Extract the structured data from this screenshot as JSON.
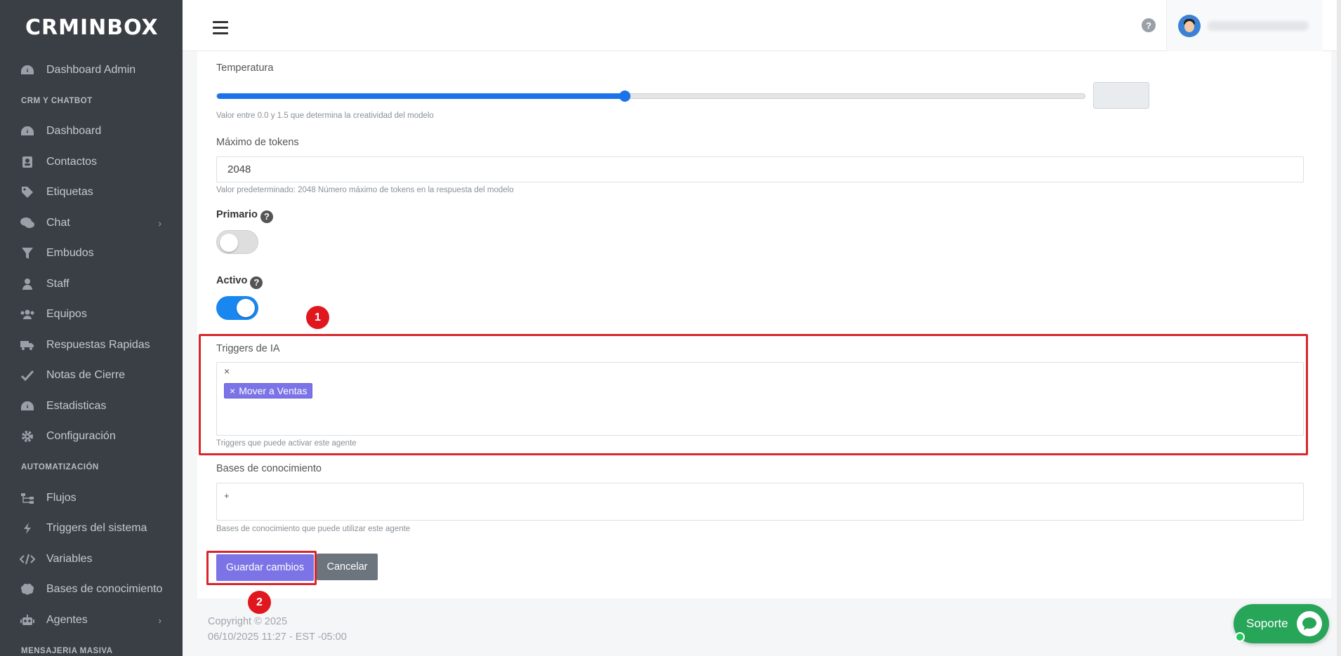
{
  "app": {
    "logo": "CRMINBOX"
  },
  "sidebar": {
    "items": [
      {
        "label": "Dashboard Admin",
        "icon": "dashboard-icon"
      },
      {
        "section": "CRM Y CHATBOT"
      },
      {
        "label": "Dashboard",
        "icon": "dashboard-icon"
      },
      {
        "label": "Contactos",
        "icon": "contacts-icon"
      },
      {
        "label": "Etiquetas",
        "icon": "tag-icon"
      },
      {
        "label": "Chat",
        "icon": "chat-icon",
        "chevron": "›"
      },
      {
        "label": "Embudos",
        "icon": "funnel-icon"
      },
      {
        "label": "Staff",
        "icon": "user-icon"
      },
      {
        "label": "Equipos",
        "icon": "users-icon"
      },
      {
        "label": "Respuestas Rapidas",
        "icon": "truck-icon"
      },
      {
        "label": "Notas de Cierre",
        "icon": "check-icon"
      },
      {
        "label": "Estadisticas",
        "icon": "dashboard-icon"
      },
      {
        "label": "Configuración",
        "icon": "gear-icon"
      },
      {
        "section": "AUTOMATIZACIÓN"
      },
      {
        "label": "Flujos",
        "icon": "sitemap-icon"
      },
      {
        "label": "Triggers del sistema",
        "icon": "bolt-icon"
      },
      {
        "label": "Variables",
        "icon": "code-icon"
      },
      {
        "label": "Bases de conocimiento",
        "icon": "brain-icon"
      },
      {
        "label": "Agentes",
        "icon": "robot-icon",
        "chevron": "›"
      },
      {
        "section": "MENSAJERIA MASIVA"
      }
    ]
  },
  "topbar": {
    "help": "?"
  },
  "form": {
    "temperature": {
      "label": "Temperatura",
      "value": 0.47,
      "hint": "Valor entre 0.0 y 1.5 que determina la creatividad del modelo"
    },
    "max_tokens": {
      "label": "Máximo de tokens",
      "value": "2048",
      "hint": "Valor predeterminado: 2048 Número máximo de tokens en la respuesta del modelo"
    },
    "primary": {
      "label": "Primario",
      "help": "?",
      "checked": false
    },
    "active": {
      "label": "Activo",
      "help": "?",
      "checked": true
    },
    "triggers": {
      "label": "Triggers de IA",
      "clear": "×",
      "tags": [
        {
          "remove": "×",
          "label": "Mover a Ventas"
        }
      ],
      "hint": "Triggers que puede activar este agente"
    },
    "knowledge": {
      "label": "Bases de conocimiento",
      "placeholder": "+",
      "hint": "Bases de conocimiento que puede utilizar este agente"
    },
    "save_label": "Guardar cambios",
    "cancel_label": "Cancelar"
  },
  "annotations": {
    "one": "1",
    "two": "2",
    "color": "#d9252b"
  },
  "footer": {
    "copyright": "Copyright © 2025",
    "datetime": "06/10/2025 11:27 - EST -05:00"
  },
  "support": {
    "label": "Soporte",
    "color": "#27a559"
  },
  "colors": {
    "sidebar": "#3a3f45",
    "accent": "#7b73e6",
    "toggle_on": "#1a86f0"
  }
}
